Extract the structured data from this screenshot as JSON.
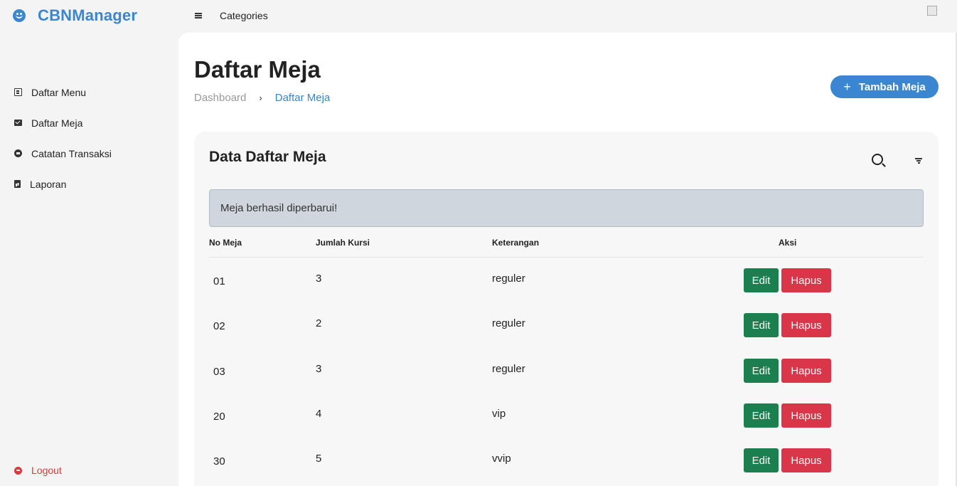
{
  "brand": {
    "name": "CBNManager"
  },
  "topbar": {
    "label": "Categories"
  },
  "sidebar": {
    "items": [
      {
        "label": "Daftar Menu",
        "icon": "book-icon"
      },
      {
        "label": "Daftar Meja",
        "icon": "envelope-icon"
      },
      {
        "label": "Catatan Transaksi",
        "icon": "arrow-circle-icon"
      },
      {
        "label": "Laporan",
        "icon": "report-file-icon"
      }
    ],
    "logout": "Logout"
  },
  "page": {
    "title": "Daftar Meja",
    "breadcrumb": {
      "home": "Dashboard",
      "separator": "›",
      "current": "Daftar Meja"
    },
    "add_button": {
      "icon": "+",
      "label": "Tambah Meja"
    }
  },
  "card": {
    "title": "Data Daftar Meja",
    "alert": "Meja berhasil diperbarui!",
    "columns": [
      "No Meja",
      "Jumlah Kursi",
      "Keterangan",
      "Aksi"
    ],
    "rows": [
      {
        "no": "01",
        "kursi": "3",
        "ket": "reguler",
        "edit": "Edit",
        "hapus": "Hapus"
      },
      {
        "no": "02",
        "kursi": "2",
        "ket": "reguler",
        "edit": "Edit",
        "hapus": "Hapus"
      },
      {
        "no": "03",
        "kursi": "3",
        "ket": "reguler",
        "edit": "Edit",
        "hapus": "Hapus"
      },
      {
        "no": "20",
        "kursi": "4",
        "ket": "vip",
        "edit": "Edit",
        "hapus": "Hapus"
      },
      {
        "no": "30",
        "kursi": "5",
        "ket": "vvip",
        "edit": "Edit",
        "hapus": "Hapus"
      }
    ]
  },
  "colors": {
    "accent": "#3a86d1",
    "edit": "#1c7f4f",
    "delete": "#d9364a",
    "logout": "#d63c3c",
    "alert_bg": "#cfd6de"
  }
}
